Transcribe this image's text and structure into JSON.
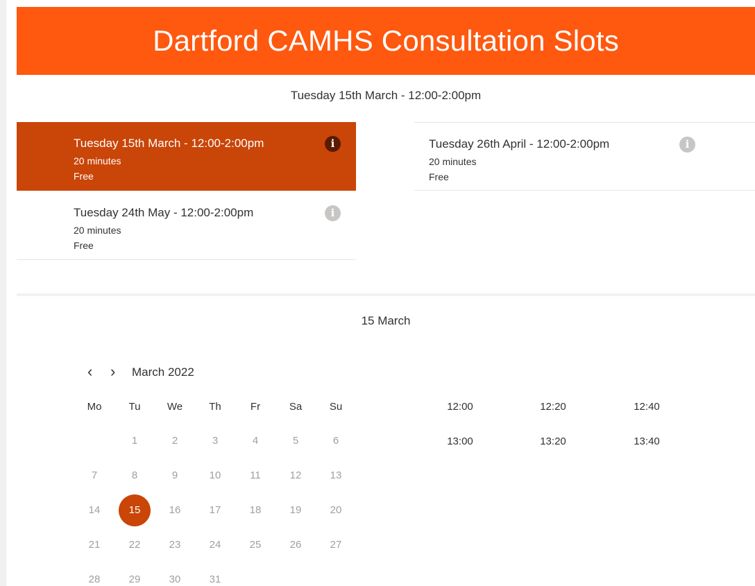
{
  "page": {
    "title": "Dartford CAMHS Consultation Slots"
  },
  "selected_service_heading": "Tuesday 15th March - 12:00-2:00pm",
  "services": [
    {
      "title": "Tuesday 15th March - 12:00-2:00pm",
      "duration": "20 minutes",
      "price": "Free",
      "selected": true
    },
    {
      "title": "Tuesday 26th April - 12:00-2:00pm",
      "duration": "20 minutes",
      "price": "Free",
      "selected": false
    },
    {
      "title": "Tuesday 24th May - 12:00-2:00pm",
      "duration": "20 minutes",
      "price": "Free",
      "selected": false
    }
  ],
  "info_icon_glyph": "i",
  "date_heading": "15 March",
  "calendar": {
    "prev_glyph": "‹",
    "next_glyph": "›",
    "month_label": "March 2022",
    "weekdays": [
      "Mo",
      "Tu",
      "We",
      "Th",
      "Fr",
      "Sa",
      "Su"
    ],
    "days": [
      "1",
      "2",
      "3",
      "4",
      "5",
      "6",
      "7",
      "8",
      "9",
      "10",
      "11",
      "12",
      "13",
      "14",
      "15",
      "16",
      "17",
      "18",
      "19",
      "20",
      "21",
      "22",
      "23",
      "24",
      "25",
      "26",
      "27",
      "28",
      "29",
      "30",
      "31"
    ],
    "selected_day": "15"
  },
  "time_slots": [
    "12:00",
    "12:20",
    "12:40",
    "13:00",
    "13:20",
    "13:40"
  ],
  "colors": {
    "banner": "#ff580f",
    "accent": "#c94508"
  }
}
